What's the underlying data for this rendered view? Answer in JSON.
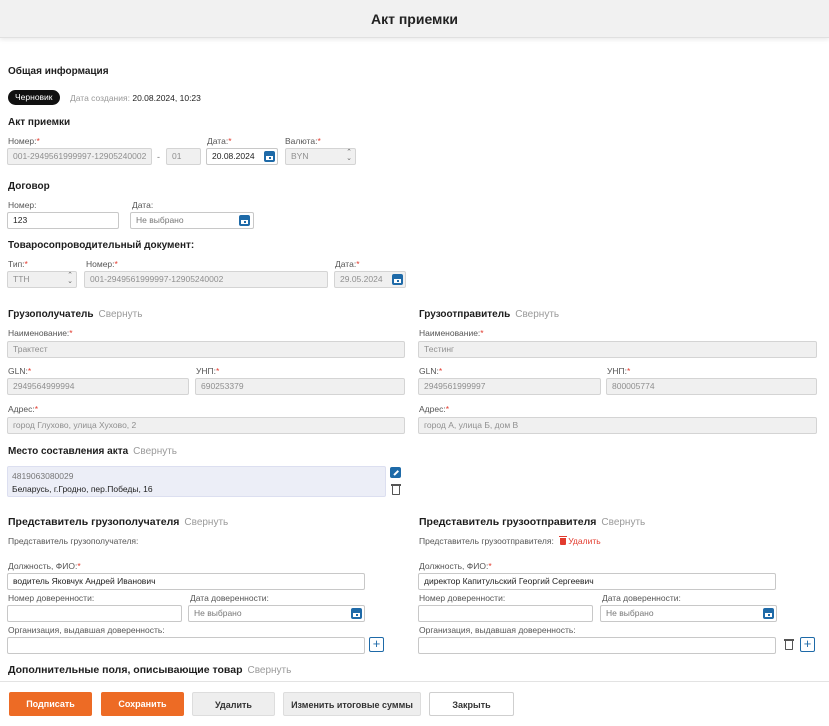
{
  "title": "Акт приемки",
  "general": {
    "heading": "Общая информация",
    "status": "Черновик",
    "created_label": "Дата создания:",
    "created_value": "20.08.2024, 10:23"
  },
  "act": {
    "heading": "Акт приемки",
    "number_label": "Номер:",
    "number_value": "001-2949561999997-12905240002",
    "separator": "-",
    "number_suffix": "01",
    "date_label": "Дата:",
    "date_value": "20.08.2024",
    "currency_label": "Валюта:",
    "currency_value": "BYN"
  },
  "contract": {
    "heading": "Договор",
    "number_label": "Номер:",
    "number_value": "123",
    "date_label": "Дата:",
    "date_placeholder": "Не выбрано"
  },
  "ttn": {
    "heading": "Товаросопроводительный документ:",
    "type_label": "Тип:",
    "type_value": "ТТН",
    "number_label": "Номер:",
    "number_value": "001-2949561999997-12905240002",
    "date_label": "Дата:",
    "date_value": "29.05.2024"
  },
  "consignee": {
    "heading": "Грузополучатель",
    "collapse": "Свернуть",
    "name_label": "Наименование:",
    "name_value": "Трактест",
    "gln_label": "GLN:",
    "gln_value": "2949564999994",
    "unp_label": "УНП:",
    "unp_value": "690253379",
    "address_label": "Адрес:",
    "address_value": "город Глухово, улица Хухово, 2"
  },
  "consignor": {
    "heading": "Грузоотправитель",
    "collapse": "Свернуть",
    "name_label": "Наименование:",
    "name_value": "Тестинг",
    "gln_label": "GLN:",
    "gln_value": "2949561999997",
    "unp_label": "УНП:",
    "unp_value": "800005774",
    "address_label": "Адрес:",
    "address_value": "город А, улица Б, дом В"
  },
  "place": {
    "heading": "Место составления акта",
    "collapse": "Свернуть",
    "code": "4819063080029",
    "address": "Беларусь, г.Гродно, пер.Победы, 16"
  },
  "rep_consignee": {
    "heading": "Представитель грузополучателя",
    "collapse": "Свернуть",
    "subtitle": "Представитель грузополучателя:",
    "position_label": "Должность, ФИО:",
    "position_value": "водитель Яковчук Андрей Иванович",
    "poa_number_label": "Номер доверенности:",
    "poa_date_label": "Дата доверенности:",
    "poa_date_placeholder": "Не выбрано",
    "org_label": "Организация, выдавшая доверенность:"
  },
  "rep_consignor": {
    "heading": "Представитель грузоотправителя",
    "collapse": "Свернуть",
    "subtitle": "Представитель грузоотправителя:",
    "delete": "Удалить",
    "position_label": "Должность, ФИО:",
    "position_value": "директор Капитульский Георгий Сергеевич",
    "poa_number_label": "Номер доверенности:",
    "poa_date_label": "Дата доверенности:",
    "poa_date_placeholder": "Не выбрано",
    "org_label": "Организация, выдавшая доверенность:"
  },
  "extra": {
    "heading": "Дополнительные поля, описывающие товар",
    "collapse": "Свернуть"
  },
  "required_mark": "*",
  "actions": {
    "sign": "Подписать",
    "save": "Сохранить",
    "delete": "Удалить",
    "change_totals": "Изменить итоговые суммы",
    "close": "Закрыть"
  },
  "colors": {
    "accent": "#ed6b25",
    "primary_blue": "#1e6aa8",
    "required": "#e23b2e"
  }
}
